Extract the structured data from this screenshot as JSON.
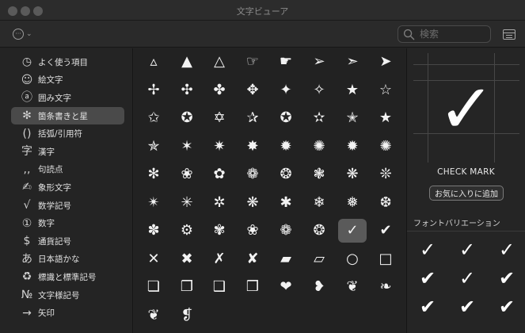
{
  "window": {
    "title": "文字ビューア"
  },
  "toolbar": {
    "more_glyph": "···",
    "chevron": "⌄",
    "search_placeholder": "検索"
  },
  "sidebar": {
    "items": [
      {
        "icon": "◷",
        "label": "よく使う項目",
        "icon_name": "clock-icon"
      },
      {
        "icon": "☺",
        "label": "絵文字",
        "icon_name": "smiley-icon"
      },
      {
        "icon": "ⓐ",
        "label": "囲み文字",
        "icon_name": "circled-a-icon"
      },
      {
        "icon": "✻",
        "label": "箇条書きと星",
        "icon_name": "asterisk-icon",
        "selected": true
      },
      {
        "icon": "()",
        "label": "括弧/引用符",
        "icon_name": "parentheses-icon"
      },
      {
        "icon": "字",
        "label": "漢字",
        "icon_name": "kanji-icon"
      },
      {
        "icon": ",,",
        "label": "句読点",
        "icon_name": "punctuation-icon"
      },
      {
        "icon": "✍",
        "label": "象形文字",
        "icon_name": "pictograph-icon"
      },
      {
        "icon": "√",
        "label": "数学記号",
        "icon_name": "square-root-icon"
      },
      {
        "icon": "①",
        "label": "数字",
        "icon_name": "circled-one-icon"
      },
      {
        "icon": "$",
        "label": "通貨記号",
        "icon_name": "dollar-icon"
      },
      {
        "icon": "あ",
        "label": "日本語かな",
        "icon_name": "hiragana-icon"
      },
      {
        "icon": "♻",
        "label": "標識と標準記号",
        "icon_name": "recycle-icon"
      },
      {
        "icon": "№",
        "label": "文字様記号",
        "icon_name": "numero-icon"
      },
      {
        "icon": "→",
        "label": "矢印",
        "icon_name": "arrow-icon"
      }
    ]
  },
  "grid": {
    "rows": [
      [
        "▵",
        "▲",
        "△",
        "☞",
        "☛",
        "➢",
        "➣",
        "➤"
      ],
      [
        "✢",
        "✣",
        "✤",
        "✥",
        "✦",
        "✧",
        "★",
        "☆"
      ],
      [
        "✩",
        "✪",
        "✡",
        "✰",
        "✪",
        "✫",
        "✭",
        "★"
      ],
      [
        "✯",
        "✶",
        "✷",
        "✸",
        "✹",
        "✺",
        "✹",
        "✺"
      ],
      [
        "✻",
        "❀",
        "✿",
        "❁",
        "❂",
        "❃",
        "❋",
        "❊"
      ],
      [
        "✴",
        "✳",
        "✲",
        "❋",
        "✱",
        "❄",
        "❅",
        "❆"
      ],
      [
        "✽",
        "⚙",
        "✾",
        "❀",
        "❁",
        "❂",
        "✓",
        "✔"
      ],
      [
        "✕",
        "✖",
        "✗",
        "✘",
        "▰",
        "▱",
        "○",
        "□"
      ],
      [
        "❏",
        "❐",
        "❑",
        "❒",
        "❤",
        "❥",
        "❦",
        "❧"
      ],
      [
        "❦",
        "❡"
      ]
    ],
    "selected": {
      "row": 6,
      "col": 6
    }
  },
  "detail": {
    "glyph": "✓",
    "char_name": "CHECK MARK",
    "favorite_button": "お気に入りに追加",
    "variation_title": "フォントバリエーション",
    "variations": [
      "✓",
      "✓",
      "✓",
      "✔",
      "✓",
      "✔",
      "✔",
      "✔",
      "✔"
    ]
  }
}
